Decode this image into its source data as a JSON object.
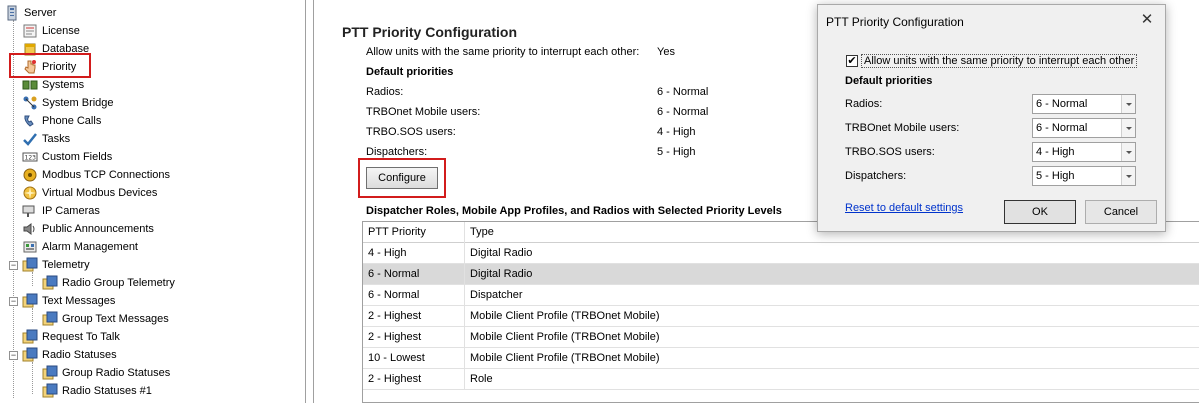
{
  "tree": {
    "items": [
      {
        "label": "Server",
        "icon": "server-icon"
      },
      {
        "label": "License",
        "icon": "license-icon"
      },
      {
        "label": "Database",
        "icon": "database-icon"
      },
      {
        "label": "Priority",
        "icon": "priority-hand-icon"
      },
      {
        "label": "Systems",
        "icon": "systems-icon"
      },
      {
        "label": "System Bridge",
        "icon": "system-bridge-icon"
      },
      {
        "label": "Phone Calls",
        "icon": "phone-icon"
      },
      {
        "label": "Tasks",
        "icon": "tasks-icon"
      },
      {
        "label": "Custom Fields",
        "icon": "custom-fields-icon"
      },
      {
        "label": "Modbus TCP Connections",
        "icon": "modbus-icon"
      },
      {
        "label": "Virtual Modbus Devices",
        "icon": "virtual-modbus-icon"
      },
      {
        "label": "IP Cameras",
        "icon": "camera-icon"
      },
      {
        "label": "Public Announcements",
        "icon": "speaker-icon"
      },
      {
        "label": "Alarm Management",
        "icon": "alarm-icon"
      },
      {
        "label": "Telemetry",
        "icon": "folder-icon"
      },
      {
        "label": "Radio Group Telemetry",
        "icon": "folder-icon"
      },
      {
        "label": "Text Messages",
        "icon": "folder-icon"
      },
      {
        "label": "Group Text Messages",
        "icon": "folder-icon"
      },
      {
        "label": "Request To Talk",
        "icon": "folder-icon"
      },
      {
        "label": "Radio Statuses",
        "icon": "folder-icon"
      },
      {
        "label": "Group Radio Statuses",
        "icon": "folder-icon"
      },
      {
        "label": "Radio Statuses #1",
        "icon": "folder-icon"
      }
    ]
  },
  "main": {
    "title": "PTT Priority Configuration",
    "allow_label": "Allow units with the same priority to interrupt each other:",
    "allow_value": "Yes",
    "default_header": "Default priorities",
    "rows": [
      {
        "label": "Radios:",
        "value": "6 - Normal"
      },
      {
        "label": "TRBOnet Mobile users:",
        "value": "6 - Normal"
      },
      {
        "label": "TRBO.SOS users:",
        "value": "4 - High"
      },
      {
        "label": "Dispatchers:",
        "value": "5 - High"
      }
    ],
    "configure_label": "Configure",
    "section_title": "Dispatcher Roles, Mobile App Profiles, and Radios with Selected Priority Levels",
    "grid": {
      "columns": [
        "PTT Priority",
        "Type"
      ],
      "rows": [
        [
          "4 - High",
          "Digital Radio"
        ],
        [
          "6 - Normal",
          "Digital Radio"
        ],
        [
          "6 - Normal",
          "Dispatcher"
        ],
        [
          "2 - Highest",
          "Mobile Client Profile (TRBOnet Mobile)"
        ],
        [
          "2 - Highest",
          "Mobile Client Profile (TRBOnet Mobile)"
        ],
        [
          "10 - Lowest",
          "Mobile Client Profile (TRBOnet Mobile)"
        ],
        [
          "2 - Highest",
          "Role"
        ]
      ],
      "selected_row": 1
    }
  },
  "dialog": {
    "title": "PTT Priority Configuration",
    "checkbox_label": "Allow units with the same priority to interrupt each other",
    "checkbox_checked": true,
    "default_header": "Default priorities",
    "fields": [
      {
        "label": "Radios:",
        "value": "6 - Normal"
      },
      {
        "label": "TRBOnet Mobile users:",
        "value": "6 - Normal"
      },
      {
        "label": "TRBO.SOS users:",
        "value": "4 - High"
      },
      {
        "label": "Dispatchers:",
        "value": "5 - High"
      }
    ],
    "reset_label": "Reset to default settings",
    "ok_label": "OK",
    "cancel_label": "Cancel"
  },
  "colors": {
    "highlight_red": "#d21c1c",
    "selected_row": "#d9d9d9",
    "link_blue": "#0033cc"
  }
}
